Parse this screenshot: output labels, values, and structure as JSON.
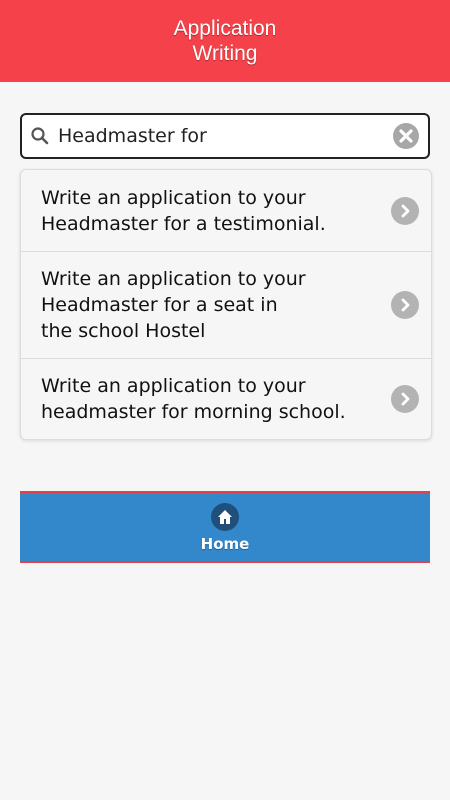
{
  "header": {
    "title": "Application Writing"
  },
  "search": {
    "value": "Headmaster for"
  },
  "results": [
    {
      "text": "Write an application to your\nHeadmaster for a testimonial."
    },
    {
      "text": "Write an application to your\nHeadmaster for a seat in\nthe school Hostel"
    },
    {
      "text": "Write an application to your\nheadmaster for morning school."
    }
  ],
  "navbar": {
    "home_label": "Home"
  },
  "colors": {
    "header_bg": "#f5424a",
    "navbar_bg": "#3388cc",
    "chevron_bg": "#b3b3b3"
  },
  "icons": {
    "search": "search-icon",
    "clear": "clear-icon",
    "chevron": "chevron-right-icon",
    "home": "home-icon"
  }
}
